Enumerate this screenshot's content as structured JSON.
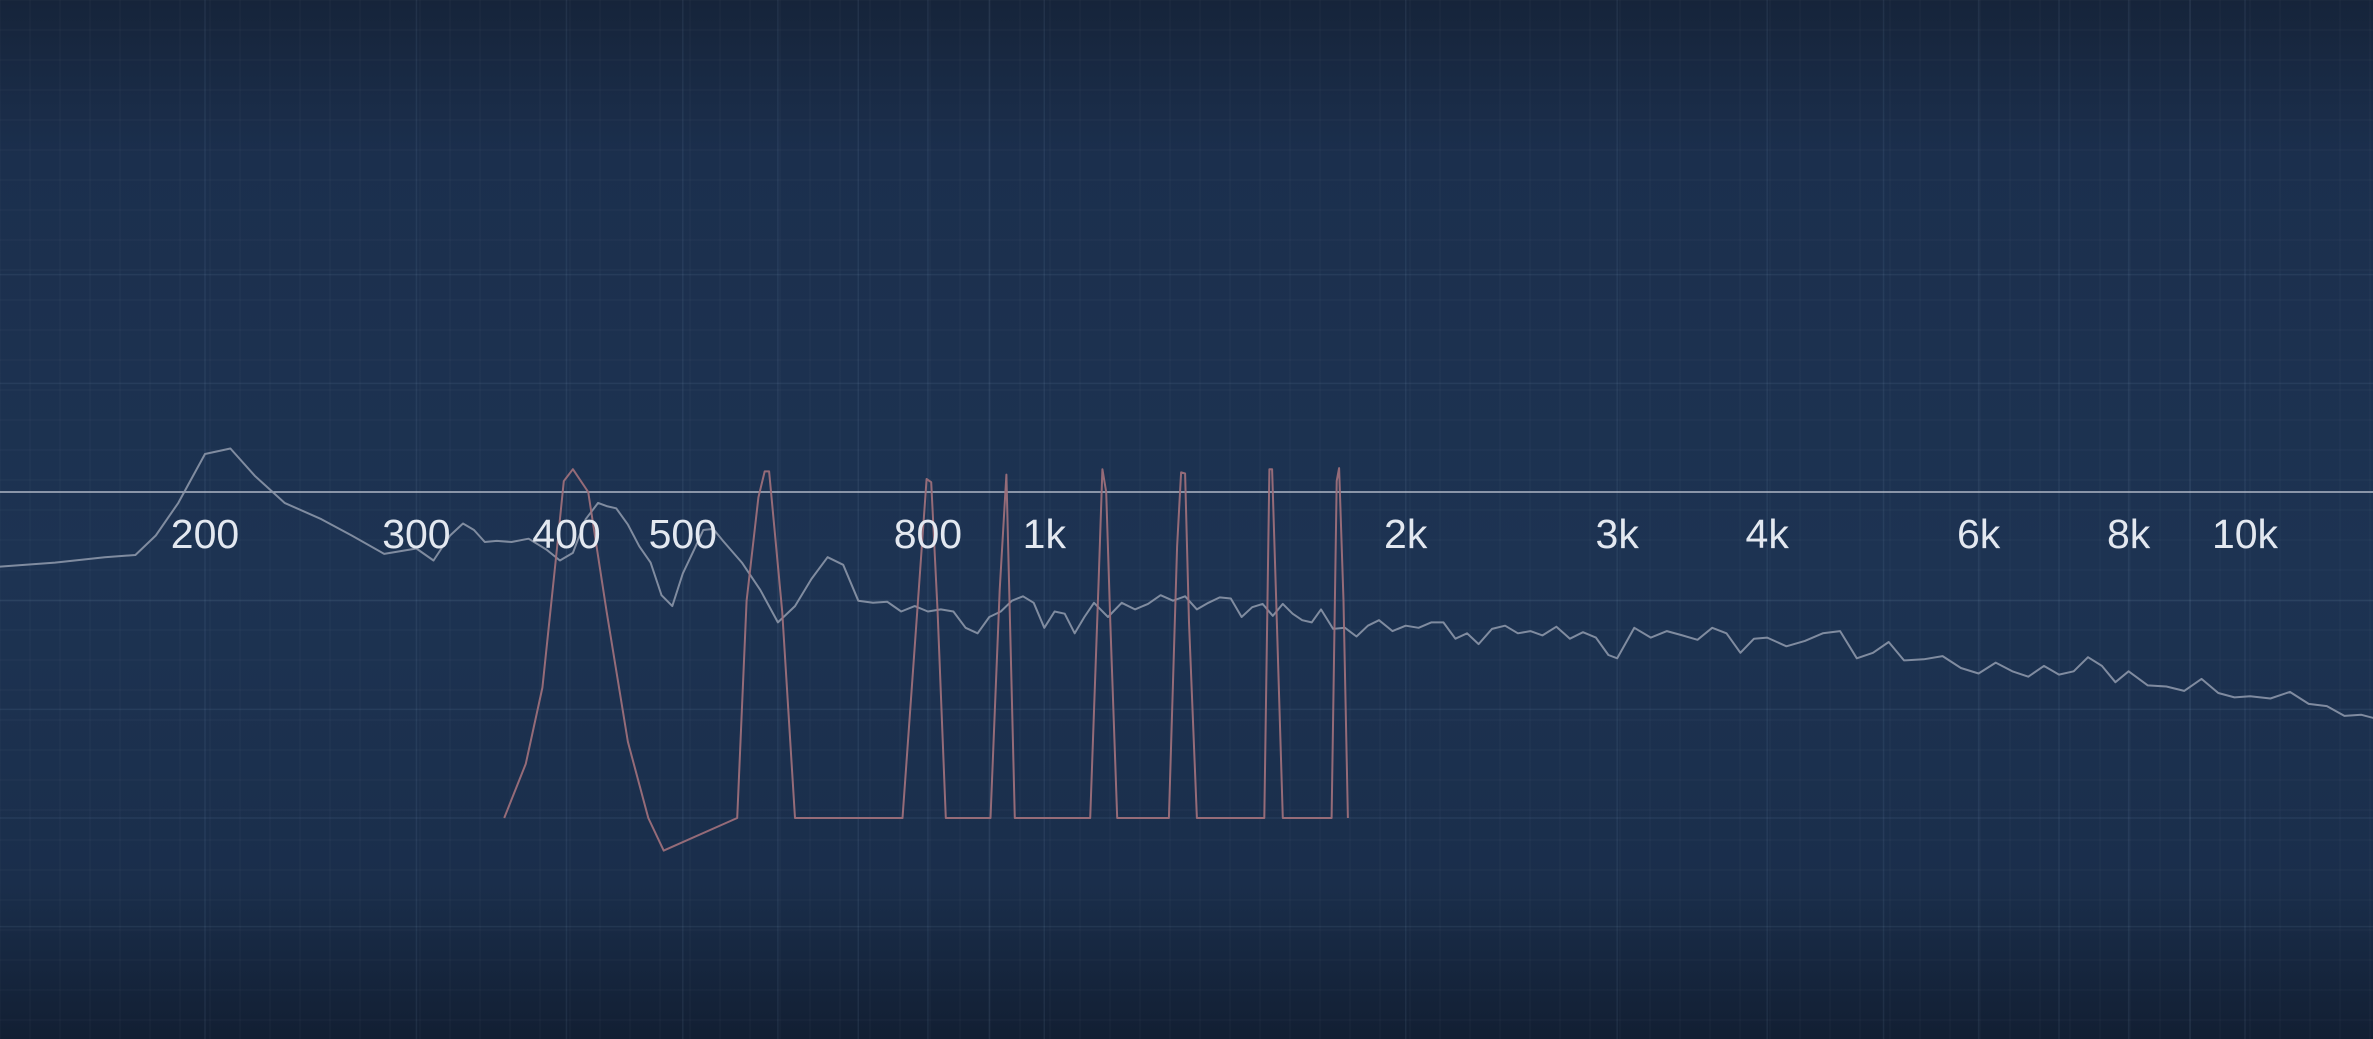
{
  "chart_data": {
    "type": "line",
    "xscale": "log",
    "xlim": [
      130,
      16000
    ],
    "grid": true,
    "title": "",
    "xlabel": "",
    "ylabel": "",
    "tick_labels": [
      "200",
      "300",
      "400",
      "500",
      "800",
      "1k",
      "2k",
      "3k",
      "4k",
      "6k",
      "8k",
      "10k"
    ],
    "tick_values": [
      200,
      300,
      400,
      500,
      800,
      1000,
      2000,
      3000,
      4000,
      6000,
      8000,
      10000
    ],
    "colors": {
      "spectrum": "#8c96a8",
      "peaks": "#9c6f7a",
      "axis": "#c8ced9",
      "label": "#e3e8f0"
    },
    "series": [
      {
        "role": "spectrum",
        "x": [
          130,
          150,
          165,
          175,
          182,
          190,
          200,
          210,
          220,
          233,
          250,
          265,
          282,
          300,
          310,
          320,
          328,
          335,
          342,
          350,
          360,
          372,
          385,
          395,
          405,
          415,
          425,
          432,
          440,
          450,
          460,
          470,
          480,
          490,
          500,
          510,
          520,
          530,
          540,
          560,
          580,
          600,
          620,
          640,
          660,
          680,
          700,
          720,
          740,
          760,
          780,
          800,
          820,
          840,
          860,
          880,
          900,
          920,
          940,
          960,
          980,
          1000,
          1020,
          1040,
          1060,
          1080,
          1100,
          1130,
          1160,
          1190,
          1220,
          1250,
          1280,
          1310,
          1340,
          1370,
          1400,
          1430,
          1460,
          1490,
          1520,
          1550,
          1580,
          1610,
          1640,
          1670,
          1700,
          1740,
          1780,
          1820,
          1860,
          1900,
          1950,
          2000,
          2050,
          2100,
          2150,
          2200,
          2250,
          2300,
          2360,
          2420,
          2480,
          2540,
          2600,
          2670,
          2740,
          2810,
          2880,
          2950,
          3000,
          3100,
          3200,
          3300,
          3400,
          3500,
          3600,
          3700,
          3800,
          3900,
          4000,
          4150,
          4300,
          4450,
          4600,
          4750,
          4900,
          5050,
          5200,
          5400,
          5600,
          5800,
          6000,
          6200,
          6400,
          6600,
          6800,
          7000,
          7200,
          7400,
          7600,
          7800,
          8000,
          8300,
          8600,
          8900,
          9200,
          9500,
          9800,
          10100,
          10500,
          10900,
          11300,
          11700,
          12100,
          12500,
          13000,
          13500,
          14000,
          14500,
          15000,
          15500,
          16000
        ],
        "y": [
          -7,
          -6.5,
          -6,
          -5.8,
          -4,
          -1,
          3.5,
          4,
          1.5,
          -1,
          -2.5,
          -4,
          -5.7,
          -5.2,
          -6.3,
          -4,
          -2.9,
          -3.5,
          -4.6,
          -4.5,
          -4.6,
          -4.3,
          -5.3,
          -6.3,
          -5.6,
          -2.5,
          -1,
          -1.3,
          -1.5,
          -3,
          -5,
          -6.5,
          -9.5,
          -10.5,
          -7.5,
          -5.5,
          -3.5,
          -3.4,
          -4.5,
          -6.5,
          -9,
          -12,
          -10.5,
          -8,
          -6,
          -6.7,
          -10,
          -10.2,
          -10.1,
          -11,
          -10.5,
          -11,
          -10.8,
          -11,
          -12.5,
          -13,
          -11.5,
          -11,
          -10,
          -9.6,
          -10.2,
          -12.5,
          -11,
          -11.2,
          -13,
          -11.5,
          -10.2,
          -11.5,
          -10.2,
          -10.8,
          -10.3,
          -9.5,
          -10,
          -9.6,
          -10.8,
          -10.2,
          -9.7,
          -9.8,
          -11.5,
          -10.6,
          -10.3,
          -11.4,
          -10.3,
          -11.2,
          -11.8,
          -12,
          -10.8,
          -12.6,
          -12.5,
          -13.3,
          -12.3,
          -11.8,
          -12.8,
          -12.3,
          -12.5,
          -12,
          -12,
          -13.5,
          -13,
          -14,
          -12.6,
          -12.3,
          -13,
          -12.8,
          -13.2,
          -12.4,
          -13.5,
          -12.9,
          -13.4,
          -15,
          -15.3,
          -12.5,
          -13.4,
          -12.8,
          -13.2,
          -13.6,
          -12.5,
          -13,
          -14.8,
          -13.5,
          -13.4,
          -14.2,
          -13.7,
          -13,
          -12.8,
          -15.3,
          -14.8,
          -13.8,
          -15.5,
          -15.4,
          -15.1,
          -16.2,
          -16.7,
          -15.7,
          -16.5,
          -17,
          -16,
          -16.8,
          -16.5,
          -15.2,
          -16,
          -17.5,
          -16.5,
          -17.8,
          -17.9,
          -18.3,
          -17.2,
          -18.5,
          -18.9,
          -18.8,
          -19,
          -18.4,
          -19.5,
          -19.7,
          -20.6,
          -20.5,
          -21,
          -20.3,
          -20.8,
          -21.5,
          -22,
          -21.5,
          -23
        ]
      },
      {
        "role": "peaks",
        "x": [
          355,
          370,
          382,
          393,
          398,
          405,
          417,
          432,
          450,
          468,
          482,
          555,
          565,
          578,
          585,
          590,
          605,
          620,
          762,
          785,
          798,
          805,
          815,
          828,
          902,
          918,
          930,
          945,
          1092,
          1110,
          1118,
          1126,
          1135,
          1150,
          1270,
          1290,
          1300,
          1310,
          1320,
          1340,
          1525,
          1540,
          1548,
          1560,
          1580,
          1735,
          1752,
          1760,
          1775,
          1790
        ],
        "y": [
          -30,
          -25,
          -18,
          -5,
          1,
          2.1,
          0,
          -11,
          -23,
          -30,
          -33,
          -30,
          -10,
          -0.5,
          1.9,
          1.9,
          -11,
          -30,
          -30,
          -10,
          1.2,
          0.9,
          -11,
          -30,
          -30,
          -9,
          1.6,
          -30,
          -30,
          -8,
          2.1,
          0,
          -12,
          -30,
          -30,
          -5,
          1.8,
          1.7,
          -12,
          -30,
          -30,
          2.1,
          2.1,
          -10,
          -30,
          -30,
          1,
          2.2,
          -10,
          -30
        ]
      }
    ]
  }
}
